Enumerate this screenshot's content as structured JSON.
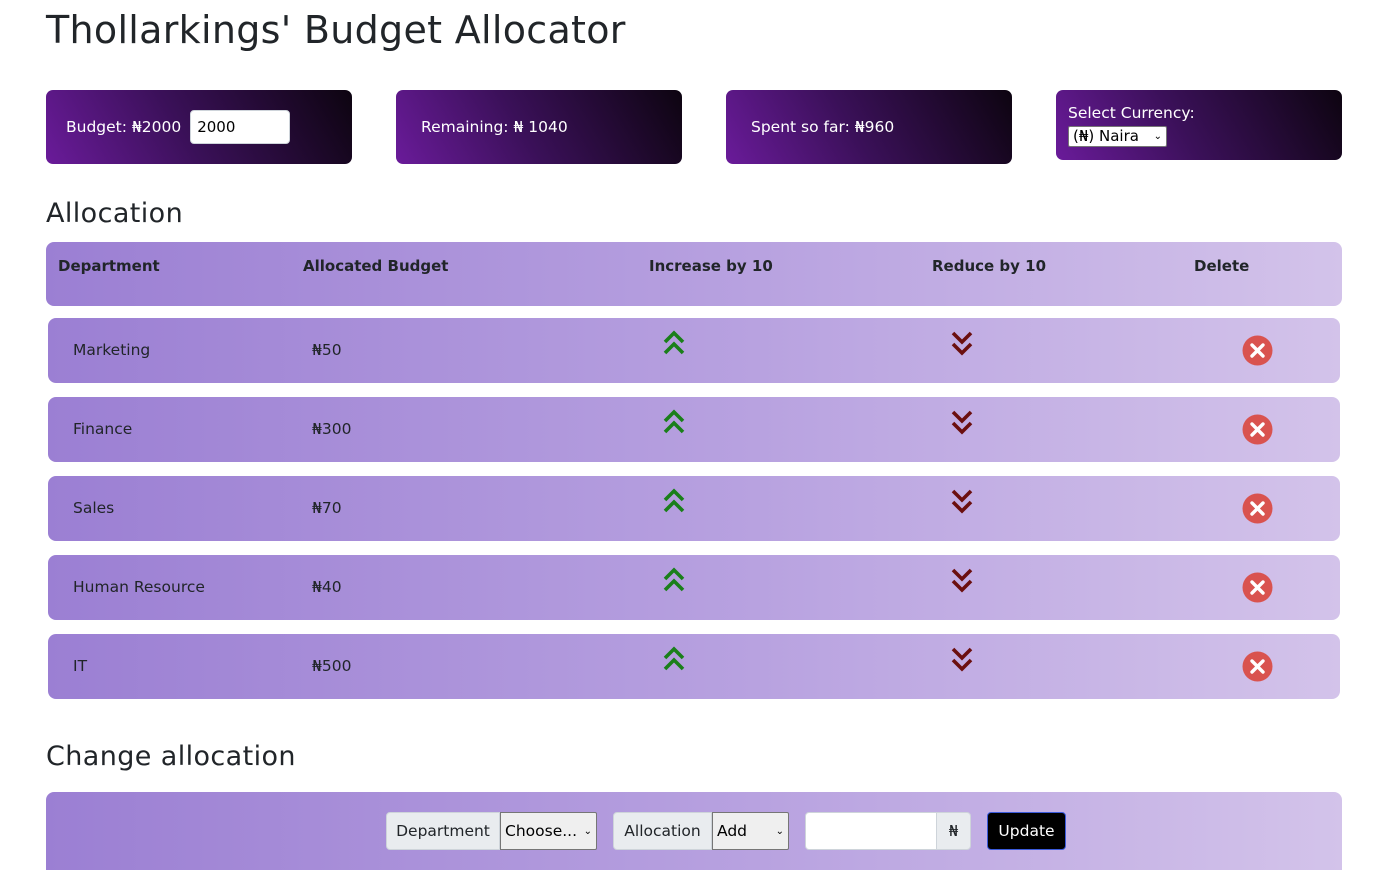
{
  "app": {
    "title": "Thollarkings' Budget Allocator"
  },
  "summary": {
    "budget_label": "Budget: ₦2000",
    "budget_input_value": "2000",
    "remaining_label": "Remaining: ₦ 1040",
    "spent_label": "Spent so far: ₦960",
    "currency_label": "Select Currency:",
    "currency_selected": "(₦) Naira"
  },
  "allocation": {
    "heading": "Allocation",
    "columns": {
      "department": "Department",
      "allocated": "Allocated Budget",
      "increase": "Increase by 10",
      "reduce": "Reduce by 10",
      "delete": "Delete"
    },
    "rows": [
      {
        "department": "Marketing",
        "budget": "₦50"
      },
      {
        "department": "Finance",
        "budget": "₦300"
      },
      {
        "department": "Sales",
        "budget": "₦70"
      },
      {
        "department": "Human Resource",
        "budget": "₦40"
      },
      {
        "department": "IT",
        "budget": "₦500"
      }
    ]
  },
  "change": {
    "heading": "Change allocation",
    "department_label": "Department",
    "department_selected": "Choose...",
    "allocation_label": "Allocation",
    "allocation_selected": "Add",
    "amount_value": "",
    "currency_symbol": "₦",
    "update_label": "Update"
  },
  "colors": {
    "increase_icon": "#1a7f1a",
    "reduce_icon": "#6b0f0f",
    "delete_icon": "#d9534f",
    "card_start": "#6a1b9a",
    "card_end": "#0d0410",
    "row_start": "#9b7fd3",
    "row_end": "#d3c3ea"
  },
  "icons": {
    "increase": "double-chevron-up-icon",
    "reduce": "double-chevron-down-icon",
    "delete": "close-circle-icon"
  }
}
